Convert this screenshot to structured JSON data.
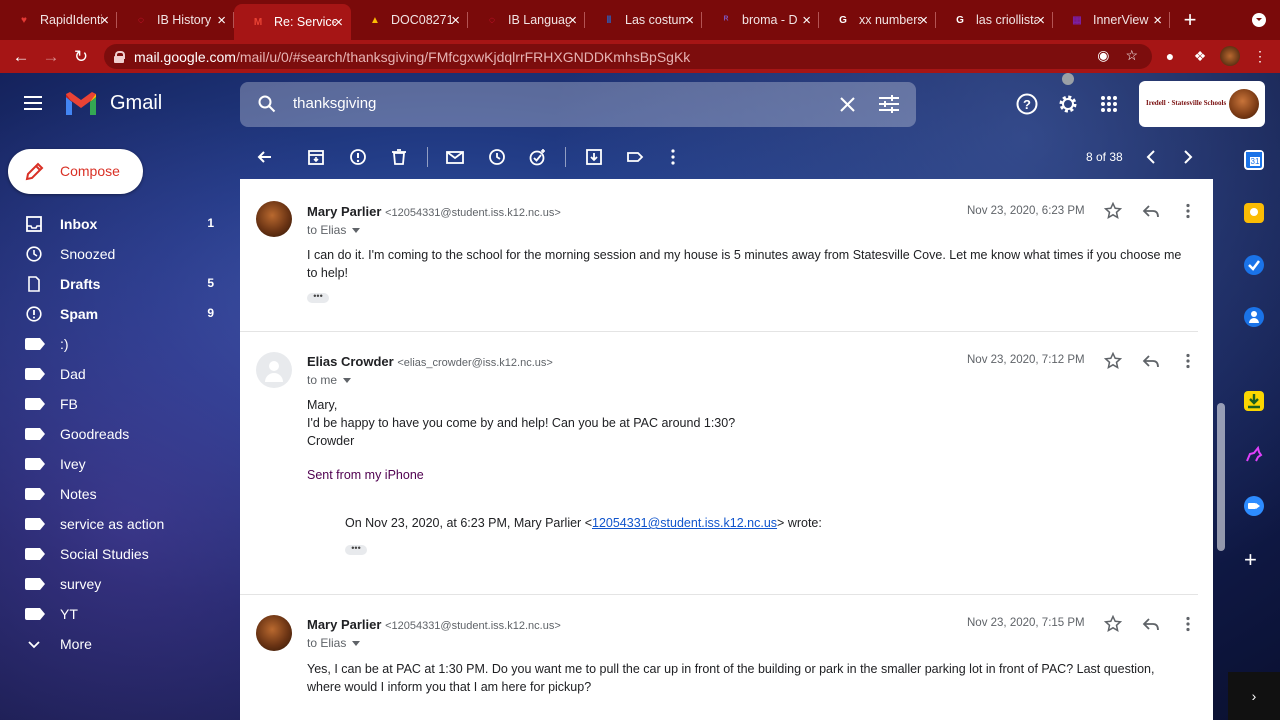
{
  "browser": {
    "tabs": [
      {
        "title": "RapidIdentity",
        "active": false,
        "color": "#e53935",
        "glyph": "♥"
      },
      {
        "title": "IB History",
        "active": false,
        "color": "#ff1744",
        "glyph": "◌"
      },
      {
        "title": "Re: Service",
        "active": true,
        "color": "#ea4335",
        "glyph": "M"
      },
      {
        "title": "DOC08271",
        "active": false,
        "color": "#fbbc04",
        "glyph": "▲"
      },
      {
        "title": "IB Language",
        "active": false,
        "color": "#ff1744",
        "glyph": "◌"
      },
      {
        "title": "Las costumbres",
        "active": false,
        "color": "#1a73e8",
        "glyph": "‖"
      },
      {
        "title": "broma - D",
        "active": false,
        "color": "#7e57c2",
        "glyph": "ᴿ"
      },
      {
        "title": "xx numbers",
        "active": false,
        "color": "#ffffff",
        "glyph": "G"
      },
      {
        "title": "las criollistas",
        "active": false,
        "color": "#ffffff",
        "glyph": "G"
      },
      {
        "title": "InnerView",
        "active": false,
        "color": "#7b1fa2",
        "glyph": "▦"
      }
    ],
    "new_tab": "+",
    "url_host": "mail.google.com",
    "url_rest": "/mail/u/0/#search/thanksgiving/FMfcgxwKjdqlrrFRHXGNDDKmhsBpSgKk"
  },
  "gmail": {
    "brand": "Gmail",
    "search_query": "thanksgiving",
    "account_label": "Iredell · Statesville Schools",
    "compose_label": "Compose",
    "pager": "8 of 38",
    "nav": [
      {
        "label": "Inbox",
        "count": "1",
        "bold": true,
        "icon": "inbox-icon"
      },
      {
        "label": "Snoozed",
        "count": "",
        "bold": false,
        "icon": "clock-icon"
      },
      {
        "label": "Drafts",
        "count": "5",
        "bold": true,
        "icon": "file-icon"
      },
      {
        "label": "Spam",
        "count": "9",
        "bold": true,
        "icon": "alert-icon"
      },
      {
        "label": ":)",
        "count": "",
        "bold": false,
        "icon": "label-icon"
      },
      {
        "label": "Dad",
        "count": "",
        "bold": false,
        "icon": "label-icon"
      },
      {
        "label": "FB",
        "count": "",
        "bold": false,
        "icon": "label-icon"
      },
      {
        "label": "Goodreads",
        "count": "",
        "bold": false,
        "icon": "label-icon"
      },
      {
        "label": "Ivey",
        "count": "",
        "bold": false,
        "icon": "label-icon"
      },
      {
        "label": "Notes",
        "count": "",
        "bold": false,
        "icon": "label-icon"
      },
      {
        "label": "service as action",
        "count": "",
        "bold": false,
        "icon": "label-icon"
      },
      {
        "label": "Social Studies",
        "count": "",
        "bold": false,
        "icon": "label-icon"
      },
      {
        "label": "survey",
        "count": "",
        "bold": false,
        "icon": "label-icon"
      },
      {
        "label": "YT",
        "count": "",
        "bold": false,
        "icon": "label-icon"
      },
      {
        "label": "More",
        "count": "",
        "bold": false,
        "icon": "chevron-down-icon"
      }
    ]
  },
  "messages": [
    {
      "sender_name": "Mary Parlier",
      "sender_addr": "<12054331@student.iss.k12.nc.us>",
      "recipient": "to Elias",
      "date": "Nov 23, 2020, 6:23 PM",
      "body": "I can do it. I'm coming to the school for the morning session and my house is 5 minutes away from Statesville Cove. Let me know what times if you choose me to help!",
      "avatar": "photo"
    },
    {
      "sender_name": "Elias Crowder",
      "sender_addr": "<elias_crowder@iss.k12.nc.us>",
      "recipient": "to me",
      "date": "Nov 23, 2020, 7:12 PM",
      "body_lines": [
        "Mary,",
        "I'd be happy to have you come by and help! Can you be at PAC around 1:30?",
        "Crowder"
      ],
      "signature": "Sent from my iPhone",
      "quote_prefix": "On Nov 23, 2020, at 6:23 PM, Mary Parlier <",
      "quote_link": "12054331@student.iss.k12.nc.us",
      "quote_suffix": "> wrote:",
      "avatar": "blank"
    },
    {
      "sender_name": "Mary Parlier",
      "sender_addr": "<12054331@student.iss.k12.nc.us>",
      "recipient": "to Elias",
      "date": "Nov 23, 2020, 7:15 PM",
      "body": "Yes, I can be at PAC at 1:30 PM. Do you want me to pull the car up in front of the building or park in the smaller parking lot in front of PAC? Last question, where would I inform you that I am here for pickup?",
      "avatar": "photo"
    }
  ],
  "ellipsis": "•••"
}
